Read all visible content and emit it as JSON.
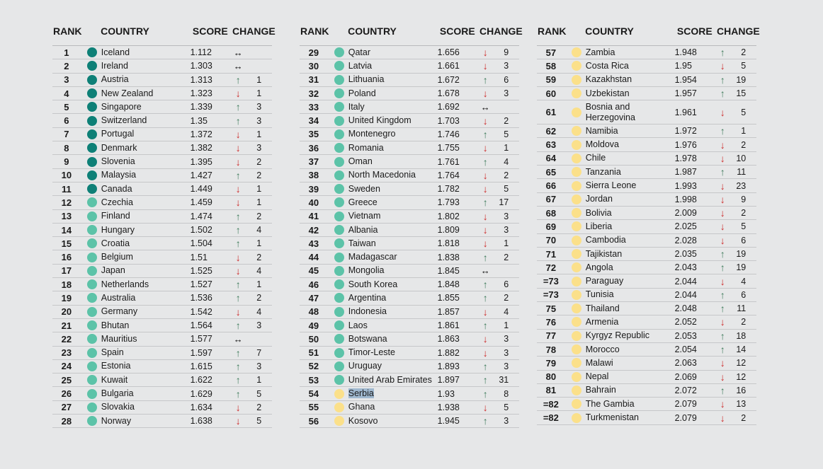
{
  "headers": {
    "rank": "RANK",
    "country": "COUNTRY",
    "score": "SCORE",
    "change": "CHANGE"
  },
  "colors": {
    "very_high": "#0e8077",
    "high": "#5cc3a8",
    "medium": "#fbe08a",
    "up": "#3d7a5a",
    "down": "#cc2a2a"
  },
  "icons": {
    "up": "↑",
    "down": "↓",
    "same": "↔"
  },
  "columns": [
    [
      {
        "rank": "1",
        "country": "Iceland",
        "score": "1.112",
        "dir": "same",
        "change": "",
        "tier": "very_high"
      },
      {
        "rank": "2",
        "country": "Ireland",
        "score": "1.303",
        "dir": "same",
        "change": "",
        "tier": "very_high"
      },
      {
        "rank": "3",
        "country": "Austria",
        "score": "1.313",
        "dir": "up",
        "change": "1",
        "tier": "very_high"
      },
      {
        "rank": "4",
        "country": "New Zealand",
        "score": "1.323",
        "dir": "down",
        "change": "1",
        "tier": "very_high"
      },
      {
        "rank": "5",
        "country": "Singapore",
        "score": "1.339",
        "dir": "up",
        "change": "3",
        "tier": "very_high"
      },
      {
        "rank": "6",
        "country": "Switzerland",
        "score": "1.35",
        "dir": "up",
        "change": "3",
        "tier": "very_high"
      },
      {
        "rank": "7",
        "country": "Portugal",
        "score": "1.372",
        "dir": "down",
        "change": "1",
        "tier": "very_high"
      },
      {
        "rank": "8",
        "country": "Denmark",
        "score": "1.382",
        "dir": "down",
        "change": "3",
        "tier": "very_high"
      },
      {
        "rank": "9",
        "country": "Slovenia",
        "score": "1.395",
        "dir": "down",
        "change": "2",
        "tier": "very_high"
      },
      {
        "rank": "10",
        "country": "Malaysia",
        "score": "1.427",
        "dir": "up",
        "change": "2",
        "tier": "very_high"
      },
      {
        "rank": "11",
        "country": "Canada",
        "score": "1.449",
        "dir": "down",
        "change": "1",
        "tier": "very_high"
      },
      {
        "rank": "12",
        "country": "Czechia",
        "score": "1.459",
        "dir": "down",
        "change": "1",
        "tier": "high"
      },
      {
        "rank": "13",
        "country": "Finland",
        "score": "1.474",
        "dir": "up",
        "change": "2",
        "tier": "high"
      },
      {
        "rank": "14",
        "country": "Hungary",
        "score": "1.502",
        "dir": "up",
        "change": "4",
        "tier": "high"
      },
      {
        "rank": "15",
        "country": "Croatia",
        "score": "1.504",
        "dir": "up",
        "change": "1",
        "tier": "high"
      },
      {
        "rank": "16",
        "country": "Belgium",
        "score": "1.51",
        "dir": "down",
        "change": "2",
        "tier": "high"
      },
      {
        "rank": "17",
        "country": "Japan",
        "score": "1.525",
        "dir": "down",
        "change": "4",
        "tier": "high"
      },
      {
        "rank": "18",
        "country": "Netherlands",
        "score": "1.527",
        "dir": "up",
        "change": "1",
        "tier": "high"
      },
      {
        "rank": "19",
        "country": "Australia",
        "score": "1.536",
        "dir": "up",
        "change": "2",
        "tier": "high"
      },
      {
        "rank": "20",
        "country": "Germany",
        "score": "1.542",
        "dir": "down",
        "change": "4",
        "tier": "high"
      },
      {
        "rank": "21",
        "country": "Bhutan",
        "score": "1.564",
        "dir": "up",
        "change": "3",
        "tier": "high"
      },
      {
        "rank": "22",
        "country": "Mauritius",
        "score": "1.577",
        "dir": "same",
        "change": "",
        "tier": "high"
      },
      {
        "rank": "23",
        "country": "Spain",
        "score": "1.597",
        "dir": "up",
        "change": "7",
        "tier": "high"
      },
      {
        "rank": "24",
        "country": "Estonia",
        "score": "1.615",
        "dir": "up",
        "change": "3",
        "tier": "high"
      },
      {
        "rank": "25",
        "country": "Kuwait",
        "score": "1.622",
        "dir": "up",
        "change": "1",
        "tier": "high"
      },
      {
        "rank": "26",
        "country": "Bulgaria",
        "score": "1.629",
        "dir": "up",
        "change": "5",
        "tier": "high"
      },
      {
        "rank": "27",
        "country": "Slovakia",
        "score": "1.634",
        "dir": "down",
        "change": "2",
        "tier": "high"
      },
      {
        "rank": "28",
        "country": "Norway",
        "score": "1.638",
        "dir": "down",
        "change": "5",
        "tier": "high"
      }
    ],
    [
      {
        "rank": "29",
        "country": "Qatar",
        "score": "1.656",
        "dir": "down",
        "change": "9",
        "tier": "high"
      },
      {
        "rank": "30",
        "country": "Latvia",
        "score": "1.661",
        "dir": "down",
        "change": "3",
        "tier": "high"
      },
      {
        "rank": "31",
        "country": "Lithuania",
        "score": "1.672",
        "dir": "up",
        "change": "6",
        "tier": "high"
      },
      {
        "rank": "32",
        "country": "Poland",
        "score": "1.678",
        "dir": "down",
        "change": "3",
        "tier": "high"
      },
      {
        "rank": "33",
        "country": "Italy",
        "score": "1.692",
        "dir": "same",
        "change": "",
        "tier": "high"
      },
      {
        "rank": "34",
        "country": "United Kingdom",
        "score": "1.703",
        "dir": "down",
        "change": "2",
        "tier": "high"
      },
      {
        "rank": "35",
        "country": "Montenegro",
        "score": "1.746",
        "dir": "up",
        "change": "5",
        "tier": "high"
      },
      {
        "rank": "36",
        "country": "Romania",
        "score": "1.755",
        "dir": "down",
        "change": "1",
        "tier": "high"
      },
      {
        "rank": "37",
        "country": "Oman",
        "score": "1.761",
        "dir": "up",
        "change": "4",
        "tier": "high"
      },
      {
        "rank": "38",
        "country": "North Macedonia",
        "score": "1.764",
        "dir": "down",
        "change": "2",
        "tier": "high"
      },
      {
        "rank": "39",
        "country": "Sweden",
        "score": "1.782",
        "dir": "down",
        "change": "5",
        "tier": "high"
      },
      {
        "rank": "40",
        "country": "Greece",
        "score": "1.793",
        "dir": "up",
        "change": "17",
        "tier": "high"
      },
      {
        "rank": "41",
        "country": "Vietnam",
        "score": "1.802",
        "dir": "down",
        "change": "3",
        "tier": "high"
      },
      {
        "rank": "42",
        "country": "Albania",
        "score": "1.809",
        "dir": "down",
        "change": "3",
        "tier": "high"
      },
      {
        "rank": "43",
        "country": "Taiwan",
        "score": "1.818",
        "dir": "down",
        "change": "1",
        "tier": "high"
      },
      {
        "rank": "44",
        "country": "Madagascar",
        "score": "1.838",
        "dir": "up",
        "change": "2",
        "tier": "high"
      },
      {
        "rank": "45",
        "country": "Mongolia",
        "score": "1.845",
        "dir": "same",
        "change": "",
        "tier": "high"
      },
      {
        "rank": "46",
        "country": "South Korea",
        "score": "1.848",
        "dir": "up",
        "change": "6",
        "tier": "high"
      },
      {
        "rank": "47",
        "country": "Argentina",
        "score": "1.855",
        "dir": "up",
        "change": "2",
        "tier": "high"
      },
      {
        "rank": "48",
        "country": "Indonesia",
        "score": "1.857",
        "dir": "down",
        "change": "4",
        "tier": "high"
      },
      {
        "rank": "49",
        "country": "Laos",
        "score": "1.861",
        "dir": "up",
        "change": "1",
        "tier": "high"
      },
      {
        "rank": "50",
        "country": "Botswana",
        "score": "1.863",
        "dir": "down",
        "change": "3",
        "tier": "high"
      },
      {
        "rank": "51",
        "country": "Timor-Leste",
        "score": "1.882",
        "dir": "down",
        "change": "3",
        "tier": "high"
      },
      {
        "rank": "52",
        "country": "Uruguay",
        "score": "1.893",
        "dir": "up",
        "change": "3",
        "tier": "high"
      },
      {
        "rank": "53",
        "country": "United Arab Emirates",
        "score": "1.897",
        "dir": "up",
        "change": "31",
        "tier": "high"
      },
      {
        "rank": "54",
        "country": "Serbia",
        "score": "1.93",
        "dir": "up",
        "change": "8",
        "tier": "medium",
        "highlight": true
      },
      {
        "rank": "55",
        "country": "Ghana",
        "score": "1.938",
        "dir": "down",
        "change": "5",
        "tier": "medium"
      },
      {
        "rank": "56",
        "country": "Kosovo",
        "score": "1.945",
        "dir": "up",
        "change": "3",
        "tier": "medium"
      }
    ],
    [
      {
        "rank": "57",
        "country": "Zambia",
        "score": "1.948",
        "dir": "up",
        "change": "2",
        "tier": "medium"
      },
      {
        "rank": "58",
        "country": "Costa Rica",
        "score": "1.95",
        "dir": "down",
        "change": "5",
        "tier": "medium"
      },
      {
        "rank": "59",
        "country": "Kazakhstan",
        "score": "1.954",
        "dir": "up",
        "change": "19",
        "tier": "medium"
      },
      {
        "rank": "60",
        "country": "Uzbekistan",
        "score": "1.957",
        "dir": "up",
        "change": "15",
        "tier": "medium"
      },
      {
        "rank": "61",
        "country": "Bosnia and Herzegovina",
        "score": "1.961",
        "dir": "down",
        "change": "5",
        "tier": "medium",
        "tall": true
      },
      {
        "rank": "62",
        "country": "Namibia",
        "score": "1.972",
        "dir": "up",
        "change": "1",
        "tier": "medium"
      },
      {
        "rank": "63",
        "country": "Moldova",
        "score": "1.976",
        "dir": "down",
        "change": "2",
        "tier": "medium"
      },
      {
        "rank": "64",
        "country": "Chile",
        "score": "1.978",
        "dir": "down",
        "change": "10",
        "tier": "medium"
      },
      {
        "rank": "65",
        "country": "Tanzania",
        "score": "1.987",
        "dir": "up",
        "change": "11",
        "tier": "medium"
      },
      {
        "rank": "66",
        "country": "Sierra Leone",
        "score": "1.993",
        "dir": "down",
        "change": "23",
        "tier": "medium"
      },
      {
        "rank": "67",
        "country": "Jordan",
        "score": "1.998",
        "dir": "down",
        "change": "9",
        "tier": "medium"
      },
      {
        "rank": "68",
        "country": "Bolivia",
        "score": "2.009",
        "dir": "down",
        "change": "2",
        "tier": "medium"
      },
      {
        "rank": "69",
        "country": "Liberia",
        "score": "2.025",
        "dir": "down",
        "change": "5",
        "tier": "medium"
      },
      {
        "rank": "70",
        "country": "Cambodia",
        "score": "2.028",
        "dir": "down",
        "change": "6",
        "tier": "medium"
      },
      {
        "rank": "71",
        "country": "Tajikistan",
        "score": "2.035",
        "dir": "up",
        "change": "19",
        "tier": "medium"
      },
      {
        "rank": "72",
        "country": "Angola",
        "score": "2.043",
        "dir": "up",
        "change": "19",
        "tier": "medium"
      },
      {
        "rank": "=73",
        "country": "Paraguay",
        "score": "2.044",
        "dir": "down",
        "change": "4",
        "tier": "medium"
      },
      {
        "rank": "=73",
        "country": "Tunisia",
        "score": "2.044",
        "dir": "up",
        "change": "6",
        "tier": "medium"
      },
      {
        "rank": "75",
        "country": "Thailand",
        "score": "2.048",
        "dir": "up",
        "change": "11",
        "tier": "medium"
      },
      {
        "rank": "76",
        "country": "Armenia",
        "score": "2.052",
        "dir": "down",
        "change": "2",
        "tier": "medium"
      },
      {
        "rank": "77",
        "country": "Kyrgyz Republic",
        "score": "2.053",
        "dir": "up",
        "change": "18",
        "tier": "medium"
      },
      {
        "rank": "78",
        "country": "Morocco",
        "score": "2.054",
        "dir": "up",
        "change": "14",
        "tier": "medium"
      },
      {
        "rank": "79",
        "country": "Malawi",
        "score": "2.063",
        "dir": "down",
        "change": "12",
        "tier": "medium"
      },
      {
        "rank": "80",
        "country": "Nepal",
        "score": "2.069",
        "dir": "down",
        "change": "12",
        "tier": "medium"
      },
      {
        "rank": "81",
        "country": "Bahrain",
        "score": "2.072",
        "dir": "up",
        "change": "16",
        "tier": "medium"
      },
      {
        "rank": "=82",
        "country": "The Gambia",
        "score": "2.079",
        "dir": "down",
        "change": "13",
        "tier": "medium"
      },
      {
        "rank": "=82",
        "country": "Turkmenistan",
        "score": "2.079",
        "dir": "down",
        "change": "2",
        "tier": "medium"
      }
    ]
  ]
}
